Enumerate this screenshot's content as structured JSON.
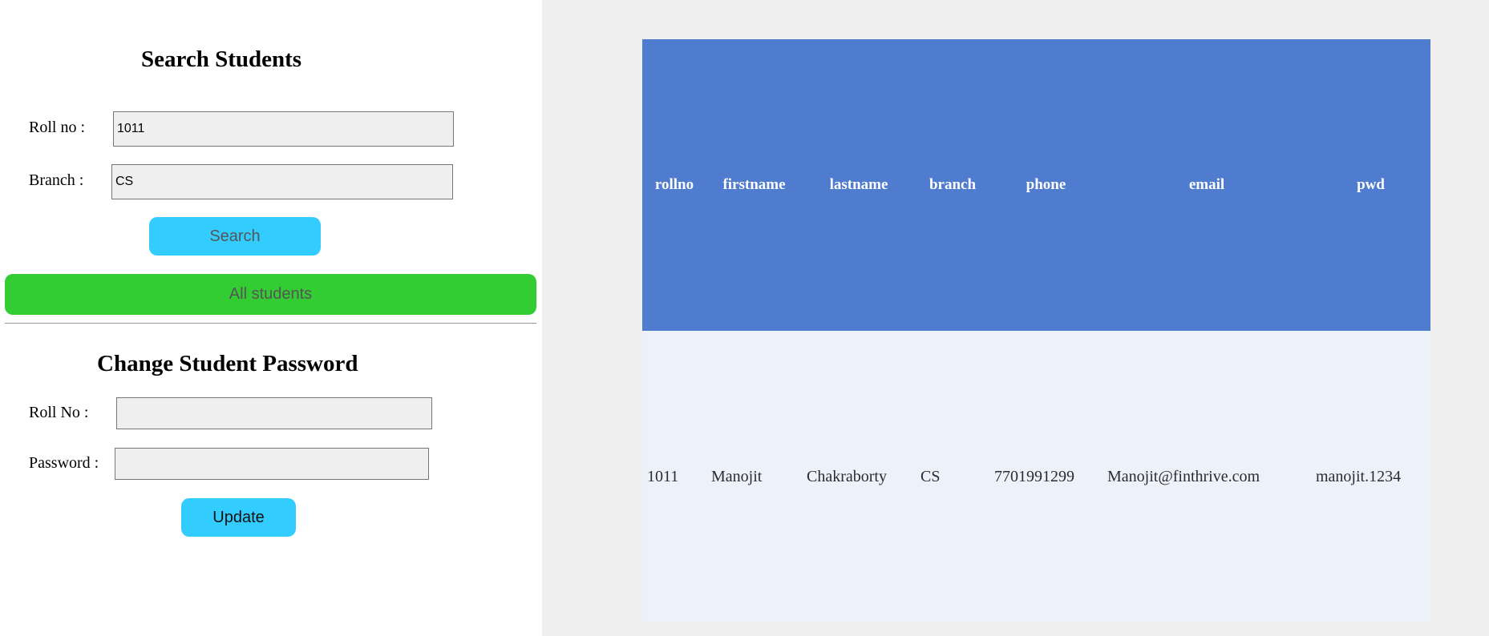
{
  "search_section": {
    "title": "Search Students",
    "rollno_label": "Roll no :",
    "rollno_value": "1011",
    "branch_label": "Branch :",
    "branch_value": "CS",
    "search_button": "Search",
    "all_students_button": "All students"
  },
  "password_section": {
    "title": "Change Student Password",
    "rollno_label": "Roll No :",
    "rollno_value": "",
    "password_label": "Password :",
    "password_value": "",
    "update_button": "Update"
  },
  "students_table": {
    "columns": [
      "rollno",
      "firstname",
      "lastname",
      "branch",
      "phone",
      "email",
      "pwd"
    ],
    "rows": [
      [
        "1011",
        "Manojit",
        "Chakraborty",
        "CS",
        "7701991299",
        "Manojit@finthrive.com",
        "manojit.1234"
      ]
    ]
  },
  "colors": {
    "search_button": "#33ccff",
    "all_students_button": "#33cc33",
    "update_button": "#33ccff",
    "table_header": "#4f7ccf",
    "table_row": "#edf1fa",
    "right_pane_bg": "#efefef"
  }
}
